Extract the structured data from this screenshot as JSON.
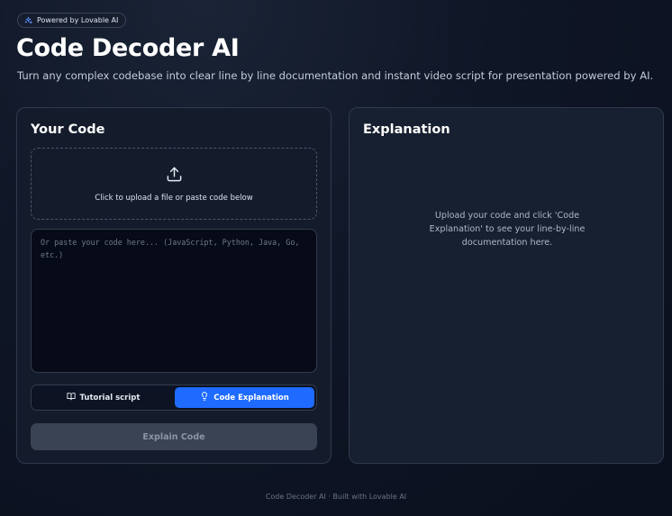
{
  "badge": {
    "label": "Powered by Lovable AI",
    "icon": "sparkle-icon"
  },
  "header": {
    "title": "Code Decoder AI",
    "subtitle": "Turn any complex codebase into clear line by line documentation and instant video script for presentation powered by AI."
  },
  "code_panel": {
    "title": "Your Code",
    "upload_text": "Click to upload a file or paste code below",
    "upload_icon": "upload-icon",
    "code_value": "",
    "code_placeholder": "Or paste your code here... (JavaScript, Python, Java, Go, etc.)",
    "modes": [
      {
        "label": "Tutorial script",
        "icon": "book-icon",
        "active": false
      },
      {
        "label": "Code Explanation",
        "icon": "lightbulb-icon",
        "active": true
      }
    ],
    "explain_button": "Explain Code"
  },
  "explanation_panel": {
    "title": "Explanation",
    "empty_message": "Upload your code and click 'Code Explanation' to see your line-by-line documentation here."
  },
  "footer": {
    "text": "Code Decoder AI · Built with Lovable AI"
  },
  "colors": {
    "accent": "#1f6bff",
    "background": "#0f1626",
    "panel": "#141c2c",
    "disabled_button": "#394354"
  }
}
